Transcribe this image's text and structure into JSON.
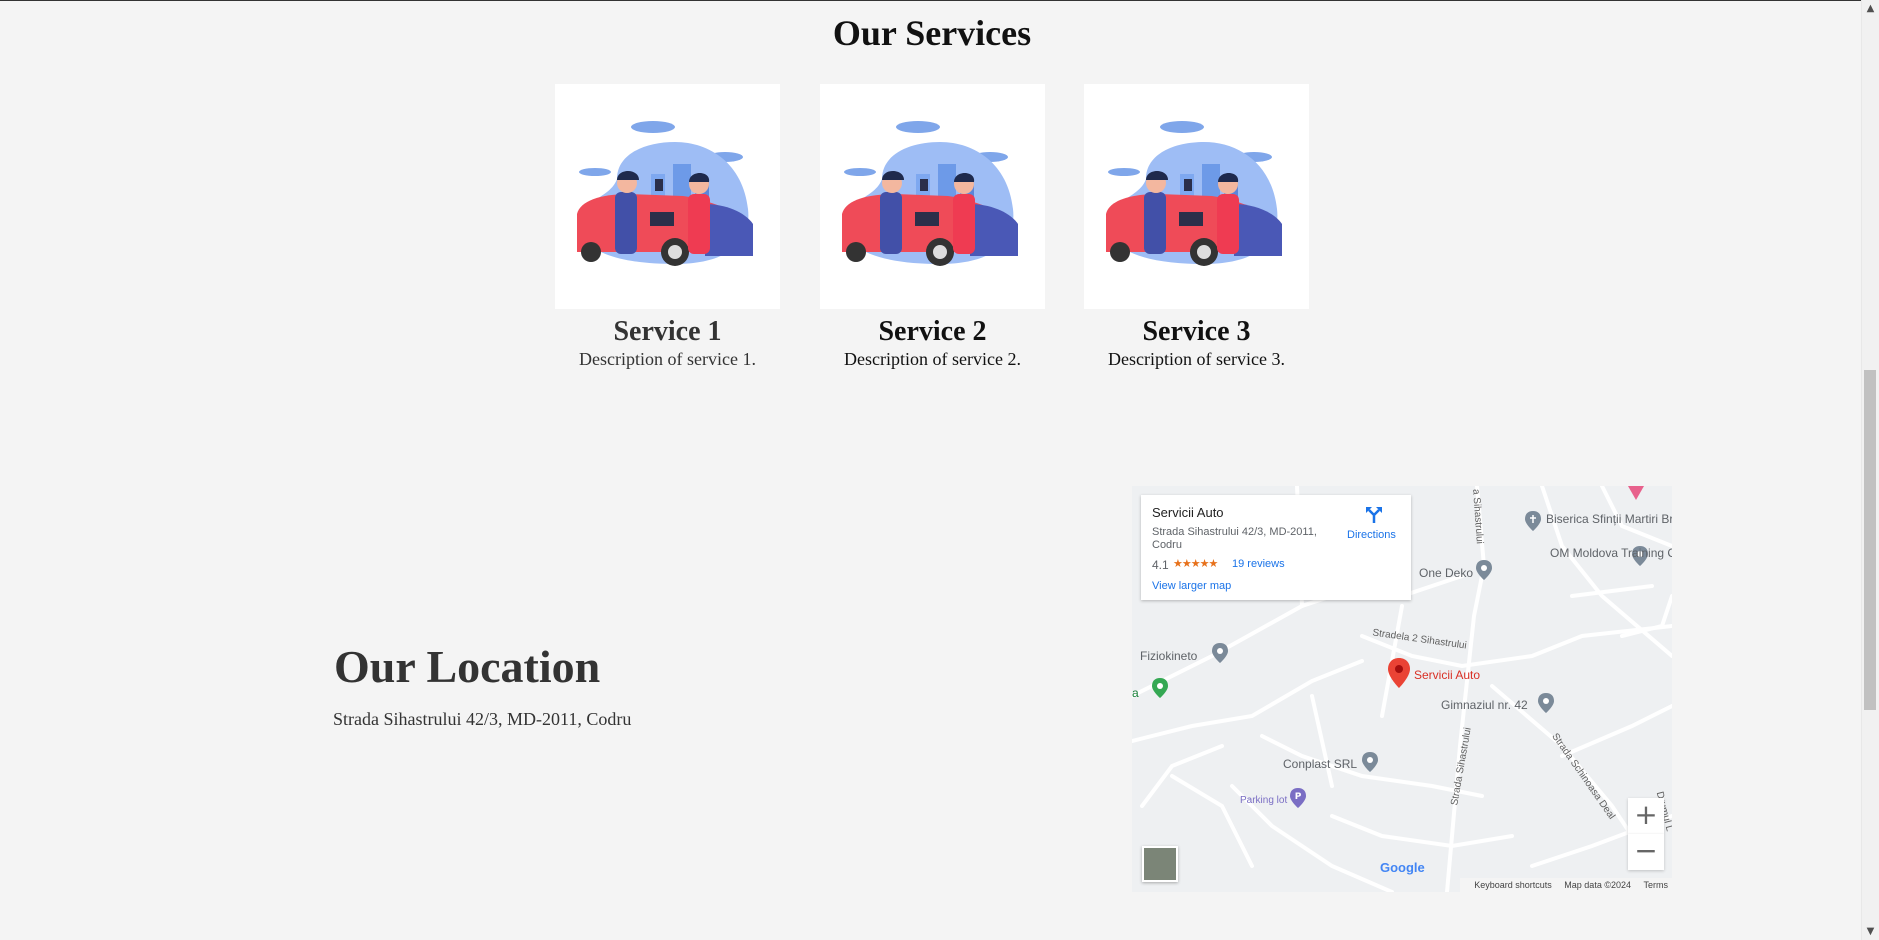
{
  "services": {
    "title": "Our Services",
    "items": [
      {
        "title": "Service 1",
        "description": "Description of service 1."
      },
      {
        "title": "Service 2",
        "description": "Description of service 2."
      },
      {
        "title": "Service 3",
        "description": "Description of service 3."
      }
    ]
  },
  "location": {
    "title": "Our Location",
    "address": "Strada Sihastrului 42/3, MD-2011, Codru"
  },
  "map": {
    "place_name": "Servicii Auto",
    "place_address": "Strada Sihastrului 42/3, MD-2011, Codru",
    "rating": "4.1",
    "stars": "★★★★★",
    "reviews": "19 reviews",
    "view_larger": "View larger map",
    "directions": "Directions",
    "marker_label": "Servicii Auto",
    "places": {
      "church": "Biserica Sfinții Martiri Brâncoveni",
      "om": "OM Moldova Training Center",
      "one_deko": "One Deko",
      "fiziokineto": "Fiziokineto",
      "gimnaziul": "Gimnaziul nr. 42",
      "conplast": "Conplast SRL",
      "parking": "Parking lot",
      "partial": "a"
    },
    "streets": {
      "stradela": "Stradela 2 Sihastrului",
      "sihastrului": "Strada Sihastrului",
      "sihastrului_top": "a Sihastrului",
      "schinoasa": "Strada Schinoasa Deal",
      "right_edge": "Drumul L"
    },
    "zoom_in": "+",
    "zoom_out": "−",
    "google": "Google",
    "footer": {
      "shortcuts": "Keyboard shortcuts",
      "data": "Map data ©2024",
      "terms": "Terms"
    }
  },
  "scrollbar": {
    "up": "▲",
    "down": "▼"
  },
  "colors": {
    "background": "#f4f4f4",
    "link": "#1a73e8",
    "marker": "#ea4335",
    "stars": "#e7711b"
  }
}
